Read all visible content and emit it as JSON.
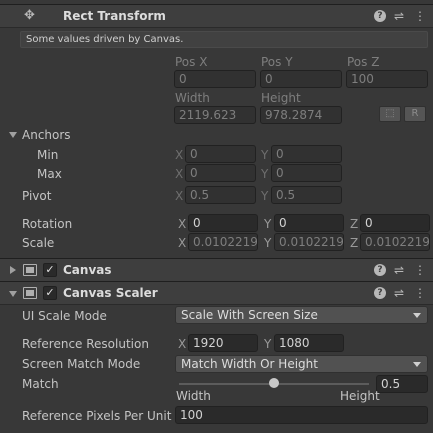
{
  "rect_transform": {
    "title": "Rect Transform",
    "info": "Some values driven by Canvas.",
    "headers": {
      "pos_x": "Pos X",
      "pos_y": "Pos Y",
      "pos_z": "Pos Z",
      "width": "Width",
      "height": "Height"
    },
    "pos_x": "0",
    "pos_y": "0",
    "pos_z": "100",
    "width": "2119.623",
    "height": "978.2874",
    "raw_button": "R",
    "anchors": {
      "label": "Anchors",
      "min_label": "Min",
      "max_label": "Max",
      "min_x": "0",
      "min_y": "0",
      "max_x": "0",
      "max_y": "0"
    },
    "pivot": {
      "label": "Pivot",
      "x": "0.5",
      "y": "0.5"
    },
    "rotation": {
      "label": "Rotation",
      "x": "0",
      "y": "0",
      "z": "0"
    },
    "scale": {
      "label": "Scale",
      "x": "0.0102219",
      "y": "0.0102219",
      "z": "0.0102219"
    },
    "axes": {
      "x": "X",
      "y": "Y",
      "z": "Z"
    }
  },
  "canvas": {
    "title": "Canvas",
    "enabled": "✓"
  },
  "canvas_scaler": {
    "title": "Canvas Scaler",
    "enabled": "✓",
    "ui_scale_mode": {
      "label": "UI Scale Mode",
      "value": "Scale With Screen Size"
    },
    "reference_resolution": {
      "label": "Reference Resolution",
      "x": "1920",
      "y": "1080"
    },
    "screen_match_mode": {
      "label": "Screen Match Mode",
      "value": "Match Width Or Height"
    },
    "match": {
      "label": "Match",
      "value": "0.5",
      "fraction": 0.5,
      "left_label": "Width",
      "right_label": "Height"
    },
    "reference_pixels_per_unit": {
      "label": "Reference Pixels Per Unit",
      "value": "100"
    }
  },
  "icons": {
    "help": "?",
    "settings": "⇌",
    "menu": "⋮"
  }
}
